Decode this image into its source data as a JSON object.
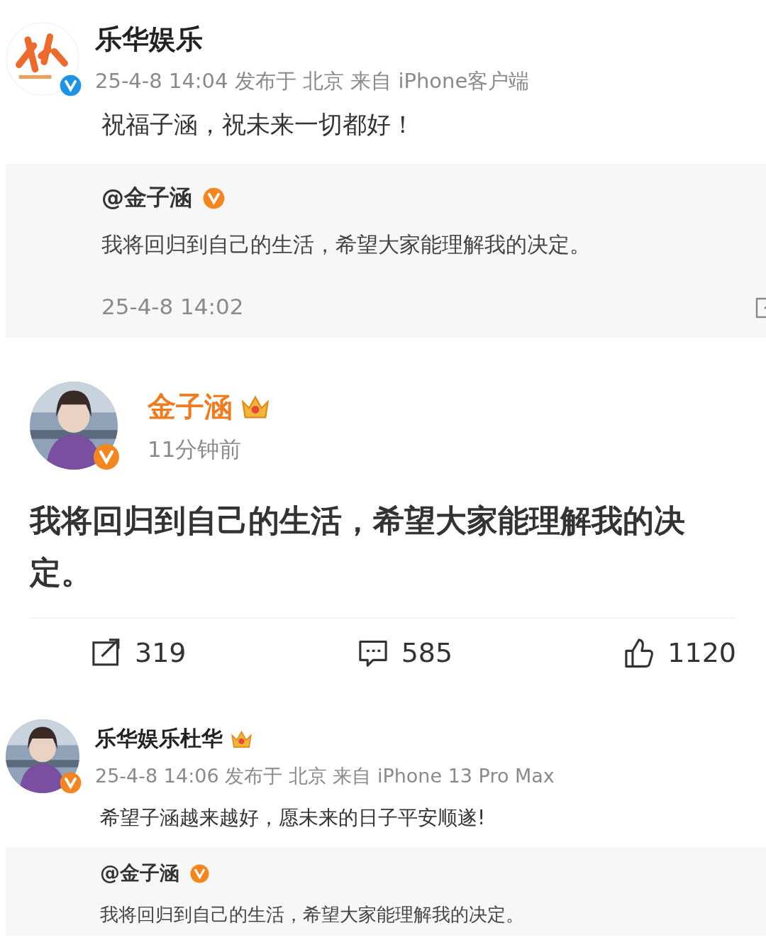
{
  "posts": [
    {
      "kind": "repost",
      "author": "乐华娱乐",
      "avatar": {
        "kind": "logo"
      },
      "verified": {
        "color": "#1e94e6"
      },
      "crown": false,
      "meta": "25-4-8 14:04 发布于 北京 来自 iPhone客户端",
      "text": "祝福子涵，祝未来一切都好！",
      "quoted": {
        "author": "@金子涵",
        "verified": {
          "color": "#f5861f"
        },
        "text": "我将回归到自己的生活，希望大家能理解我的决定。",
        "time": "25-4-8 14:02"
      }
    },
    {
      "kind": "original",
      "author": "金子涵",
      "verified": {
        "color": "#f5861f"
      },
      "crown": true,
      "meta": "11分钟前",
      "text": "我将回归到自己的生活，希望大家能理解我的决定。",
      "actions": [
        {
          "kind": "share",
          "count": "319"
        },
        {
          "kind": "comment",
          "count": "585"
        },
        {
          "kind": "like",
          "count": "1120"
        }
      ]
    },
    {
      "kind": "repost",
      "author": "乐华娱乐杜华",
      "verified": {
        "color": "#f5861f"
      },
      "crown": true,
      "meta": "25-4-8 14:06 发布于 北京 来自 iPhone 13 Pro Max",
      "text": "希望子涵越来越好，愿未来的日子平安顺遂!",
      "quoted": {
        "author": "@金子涵",
        "verified": {
          "color": "#f5861f"
        },
        "text": "我将回归到自己的生活，希望大家能理解我的决定。"
      }
    }
  ]
}
